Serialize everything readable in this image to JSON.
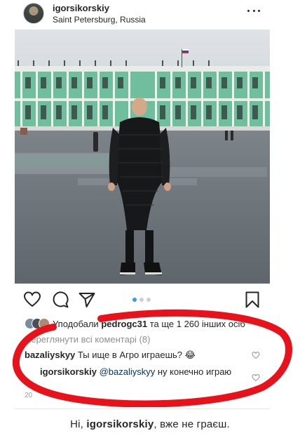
{
  "post": {
    "username": "igorsikorskiy",
    "location": "Saint Petersburg, Russia",
    "carousel": {
      "total": 3,
      "active": 1
    },
    "likes": {
      "prefix": "Уподобали",
      "name": "pedrogc31",
      "suffix": " та ще 1 260 інших осіб"
    },
    "view_comments": "Переглянути всі коментарі (8)",
    "comments": [
      {
        "user": "bazaliyskyy",
        "text": "Ты ище в Агро играешь? 😂"
      },
      {
        "user": "igorsikorskiy",
        "mention": "@bazaliyskyy",
        "text": " ну конечно играю"
      }
    ],
    "timestamp": "20"
  },
  "bottom_note": {
    "before": "Ні, ",
    "name": "igorsikorskiy",
    "after": ", вже не граєш."
  },
  "colors": {
    "accent_blue": "#3897f0",
    "annotation_red": "#e8121a",
    "text": "#262626",
    "muted": "#8e8e8e"
  },
  "icons": [
    "avatar",
    "more-icon",
    "heart-icon",
    "comment-icon",
    "share-icon",
    "bookmark-icon"
  ]
}
